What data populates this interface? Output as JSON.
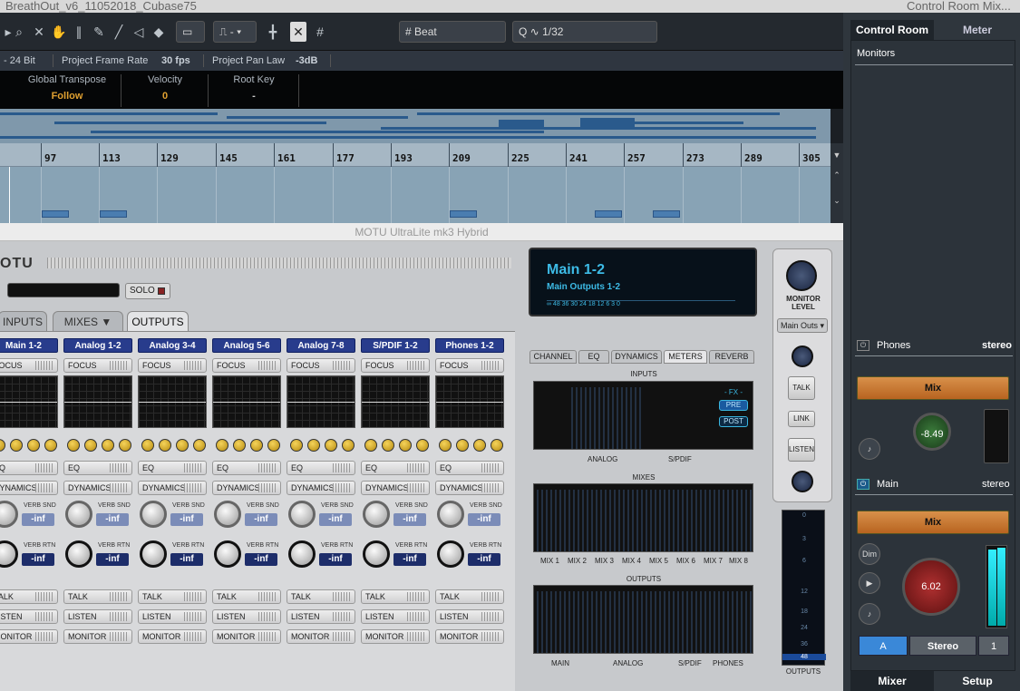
{
  "cubase": {
    "title": "BreathOut_v6_11052018_Cubase75",
    "quantize_mode": "Beat",
    "quantize_value": "1/32",
    "info": {
      "bit": "- 24 Bit",
      "frame_rate_label": "Project Frame Rate",
      "frame_rate": "30 fps",
      "pan_law_label": "Project Pan Law",
      "pan_law": "-3dB"
    },
    "infoline": [
      {
        "label": "Global Transpose",
        "value": "Follow"
      },
      {
        "label": "Velocity",
        "value": "0"
      },
      {
        "label": "Root Key",
        "value": "-"
      }
    ],
    "ruler": [
      "97",
      "113",
      "129",
      "145",
      "161",
      "177",
      "193",
      "209",
      "225",
      "241",
      "257",
      "273",
      "289",
      "305"
    ]
  },
  "motu": {
    "title": "MOTU UltraLite mk3 Hybrid",
    "logo": "OTU",
    "solo": "SOLO",
    "tabs": [
      "INPUTS",
      "MIXES ▼",
      "OUTPUTS"
    ],
    "channels": [
      "Main 1-2",
      "Analog 1-2",
      "Analog 3-4",
      "Analog 5-6",
      "Analog 7-8",
      "S/PDIF 1-2",
      "Phones 1-2"
    ],
    "btn": {
      "focus": "FOCUS",
      "eq": "EQ",
      "dynamics": "DYNAMICS",
      "talk": "TALK",
      "listen": "LISTEN",
      "monitor": "MONITOR"
    },
    "verb_snd": "VERB SND",
    "verb_rtn": "VERB RTN",
    "inf": "-inf",
    "meter_title": "Main 1-2",
    "meter_sub": "Main Outputs 1-2",
    "meter_scale": "∞  48 36 30 24      18          12            6            3            0",
    "right_tabs": [
      "CHANNEL",
      "EQ",
      "DYNAMICS",
      "METERS",
      "REVERB"
    ],
    "sections": {
      "inputs": "INPUTS",
      "mixes": "MIXES",
      "outputs": "OUTPUTS"
    },
    "fx": {
      "label": "- FX -",
      "pre": "PRE",
      "post": "POST"
    },
    "input_labels": [
      "ANALOG",
      "S/PDIF"
    ],
    "mix_labels": [
      "MIX 1",
      "MIX 2",
      "MIX 3",
      "MIX 4",
      "MIX 5",
      "MIX 6",
      "MIX 7",
      "MIX 8"
    ],
    "output_labels": [
      "MAIN",
      "ANALOG",
      "S/PDIF",
      "PHONES"
    ],
    "monitor_level": "MONITOR LEVEL",
    "main_outs": "Main Outs ▾",
    "mon_btns": [
      "TALK",
      "LINK",
      "LISTEN"
    ],
    "meter_ticks": [
      "0",
      "3",
      "6",
      "12",
      "18",
      "24",
      "36",
      "48"
    ],
    "outputs_label": "OUTPUTS"
  },
  "control_room": {
    "title": "Control Room Mix...",
    "tabs": [
      "Control Room",
      "Meter"
    ],
    "monitors": "Monitors",
    "phones": {
      "label": "Phones",
      "format": "stereo",
      "mix": "Mix",
      "level": "-8.49"
    },
    "main": {
      "label": "Main",
      "format": "stereo",
      "mix": "Mix",
      "level": "6.02",
      "dim": "Dim"
    },
    "bottom_btns": [
      "A",
      "Stereo",
      "1"
    ],
    "bottom_tabs": [
      "Mixer",
      "Setup"
    ]
  }
}
